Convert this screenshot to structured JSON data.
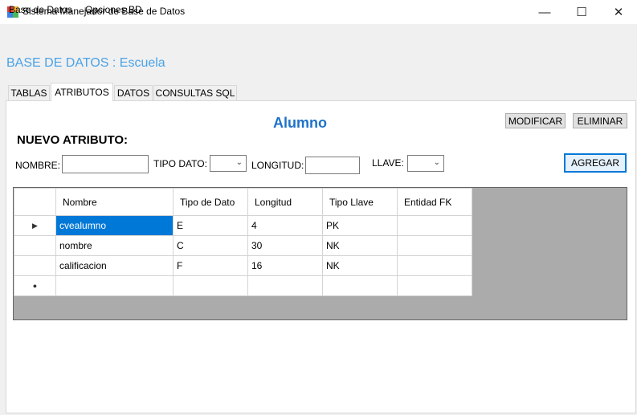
{
  "window": {
    "title": "Sistema Manejador de Base de Datos",
    "minimize": "—",
    "maximize": "☐",
    "close": "✕"
  },
  "menu": {
    "items": [
      "Base de Datos",
      "Opciones BD"
    ]
  },
  "database_title": "BASE DE DATOS : Escuela",
  "tabs": [
    "TABLAS",
    "ATRIBUTOS",
    "DATOS",
    "CONSULTAS SQL"
  ],
  "active_tab": "ATRIBUTOS",
  "table_name": "Alumno",
  "buttons": {
    "modificar": "MODIFICAR",
    "eliminar": "ELIMINAR",
    "agregar": "AGREGAR"
  },
  "form": {
    "heading": "NUEVO ATRIBUTO:",
    "nombre_label": "NOMBRE:",
    "nombre_value": "",
    "tipo_dato_label": "TIPO DATO:",
    "tipo_dato_value": "",
    "longitud_label": "LONGITUD:",
    "longitud_value": "",
    "llave_label": "LLAVE:",
    "llave_value": ""
  },
  "grid": {
    "columns": [
      "Nombre",
      "Tipo de Dato",
      "Longitud",
      "Tipo Llave",
      "Entidad FK"
    ],
    "rows": [
      {
        "indicator": "▶",
        "cells": [
          "cvealumno",
          "E",
          "4",
          "PK",
          ""
        ]
      },
      {
        "indicator": "",
        "cells": [
          "nombre",
          "C",
          "30",
          "NK",
          ""
        ]
      },
      {
        "indicator": "",
        "cells": [
          "calificacion",
          "F",
          "16",
          "NK",
          ""
        ]
      },
      {
        "indicator": "●",
        "cells": [
          "",
          "",
          "",
          "",
          ""
        ]
      }
    ]
  },
  "colors": {
    "db_title": "#4aa3e8",
    "table_name": "#1e72c8",
    "selection": "#0078d7",
    "grid_background": "#ababab"
  }
}
